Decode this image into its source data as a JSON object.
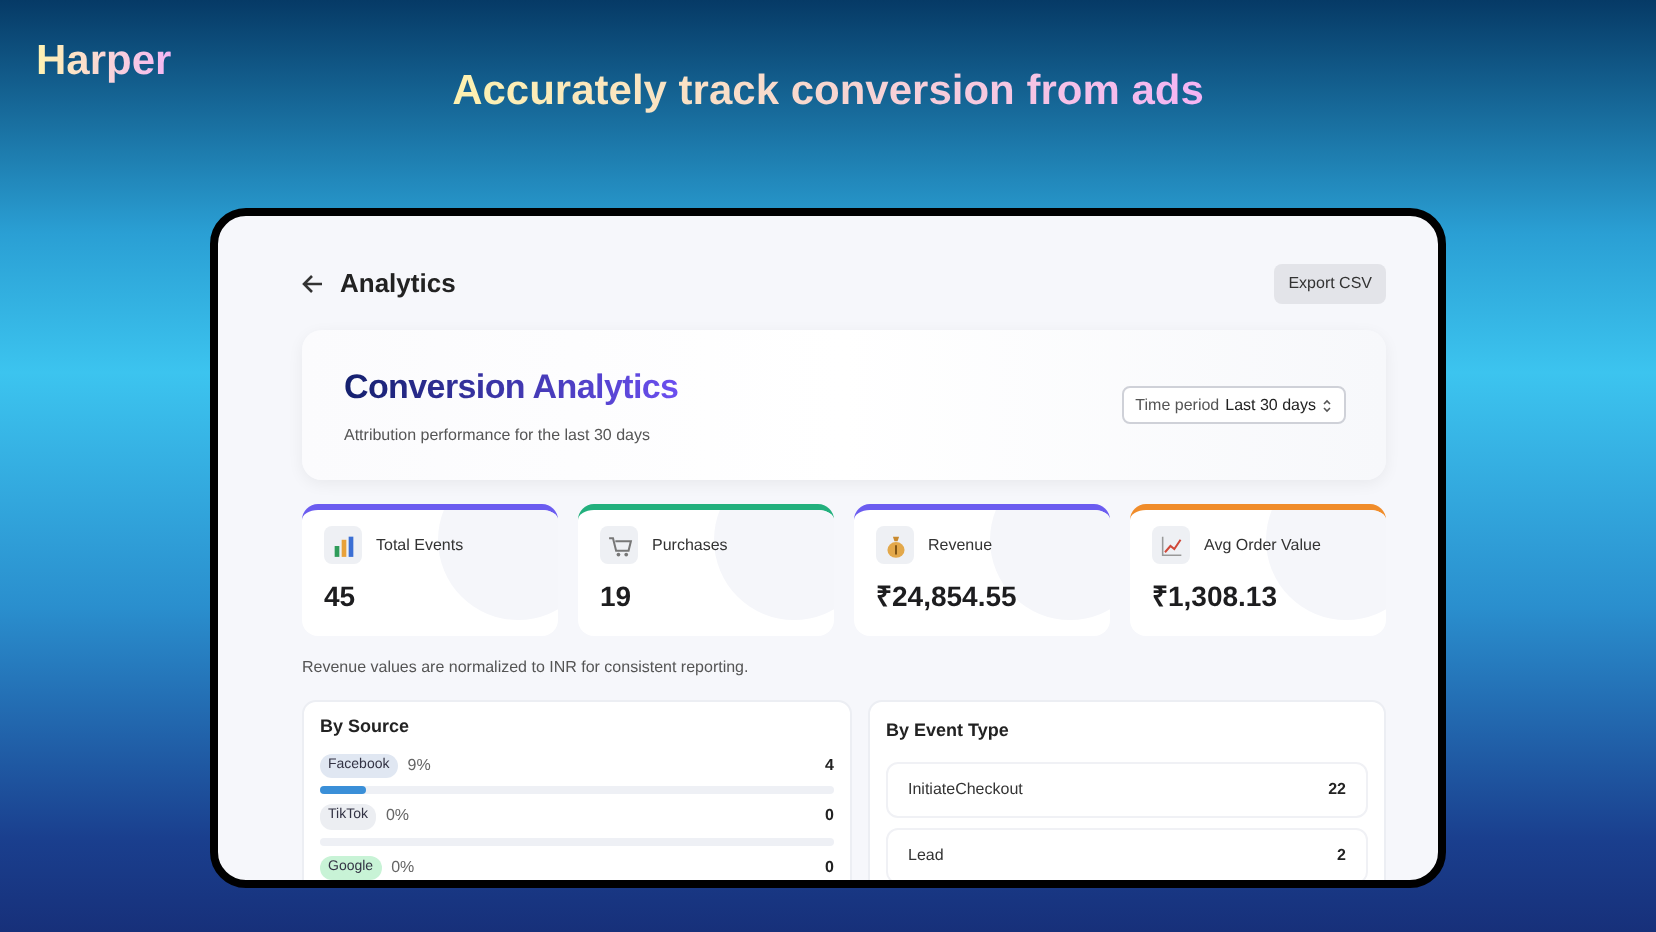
{
  "brand": "Harper",
  "tagline": "Accurately track conversion from ads",
  "title": "Analytics",
  "export_button": "Export CSV",
  "hero": {
    "title": "Conversion Analytics",
    "subtitle": "Attribution performance for the last 30 days",
    "period_label": "Time period",
    "period_value": "Last 30 days"
  },
  "stats": [
    {
      "kind": "bars",
      "label": "Total Events",
      "value": "45",
      "color": "#6b5cf0"
    },
    {
      "kind": "cart",
      "label": "Purchases",
      "value": "19",
      "color": "#22b07d"
    },
    {
      "kind": "bag",
      "label": "Revenue",
      "value": "₹24,854.55",
      "color": "#6b5cf0"
    },
    {
      "kind": "trend",
      "label": "Avg Order Value",
      "value": "₹1,308.13",
      "color": "#f08c2a"
    }
  ],
  "note": "Revenue values are normalized to INR for consistent reporting.",
  "by_source": {
    "title": "By Source",
    "rows": [
      {
        "name": "Facebook",
        "share": "9%",
        "count": "4",
        "level": 0.09,
        "color": "#e0e7f2"
      },
      {
        "name": "TikTok",
        "share": "0%",
        "count": "0",
        "level": 0,
        "color": "#eceef2"
      },
      {
        "name": "Google",
        "share": "0%",
        "count": "0",
        "color": "#c8f3d6"
      }
    ]
  },
  "by_event_type": {
    "title": "By Event Type",
    "rows": [
      {
        "name": "InitiateCheckout",
        "count": "22"
      },
      {
        "name": "Lead",
        "count": "2"
      }
    ]
  }
}
